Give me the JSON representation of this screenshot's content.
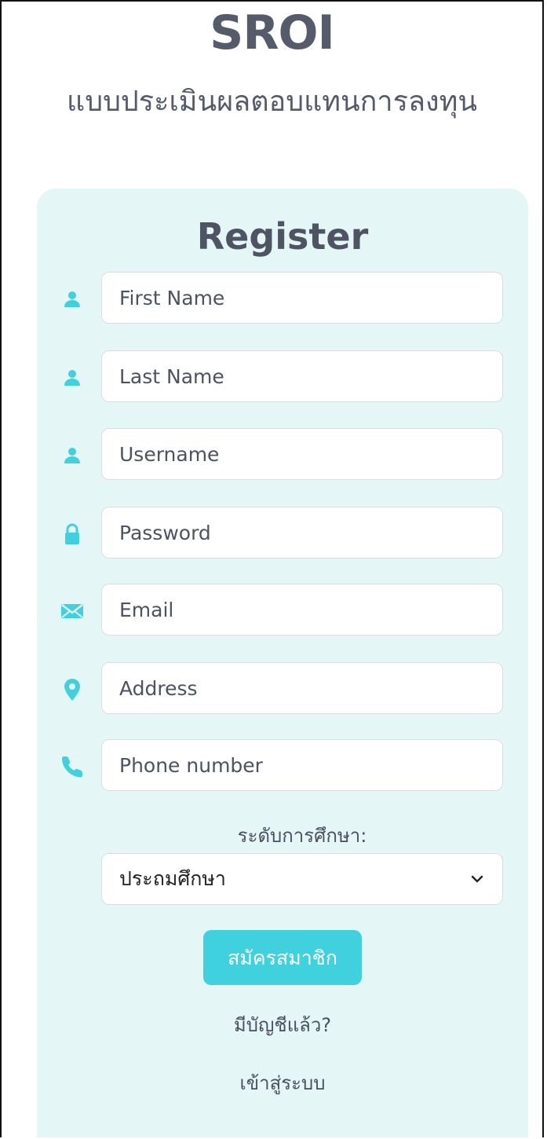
{
  "header": {
    "title": "SROI",
    "subtitle": "แบบประเมินผลตอบแทนการลงทุน"
  },
  "form": {
    "title": "Register",
    "fields": [
      {
        "name": "first-name",
        "icon": "user-icon",
        "placeholder": "First Name",
        "value": ""
      },
      {
        "name": "last-name",
        "icon": "user-icon",
        "placeholder": "Last Name",
        "value": ""
      },
      {
        "name": "username",
        "icon": "user-icon",
        "placeholder": "Username",
        "value": ""
      },
      {
        "name": "password",
        "icon": "lock-icon",
        "placeholder": "Password",
        "value": ""
      },
      {
        "name": "email",
        "icon": "envelope-icon",
        "placeholder": "Email",
        "value": ""
      },
      {
        "name": "address",
        "icon": "map-marker-icon",
        "placeholder": "Address",
        "value": ""
      },
      {
        "name": "phone",
        "icon": "phone-icon",
        "placeholder": "Phone number",
        "value": ""
      }
    ],
    "education_label": "ระดับการศึกษา:",
    "education_selected": "ประถมศึกษา",
    "submit_label": "สมัครสมาชิก",
    "have_account_text": "มีบัญชีแล้ว?",
    "login_link_label": "เข้าสู่ระบบ"
  },
  "colors": {
    "accent": "#3fd2de",
    "card_background": "#e5f6f6",
    "icon_color": "#3fd2de"
  }
}
